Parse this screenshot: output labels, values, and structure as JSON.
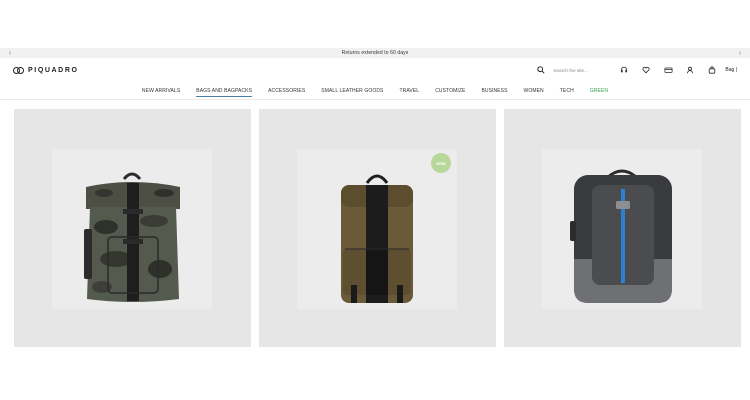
{
  "promo": {
    "text": "Returns extended to 60 days",
    "prev_icon": "chevron-left-icon",
    "next_icon": "chevron-right-icon"
  },
  "header": {
    "logo_text": "PIQUADRO",
    "search_placeholder": "Search the site...",
    "bag_label": "Bag |",
    "icons": [
      "search-icon",
      "support-icon",
      "heart-icon",
      "card-icon",
      "user-icon",
      "bag-icon"
    ]
  },
  "nav": {
    "items": [
      {
        "label": "NEW ARRIVALS"
      },
      {
        "label": "BAGS AND BAGPACKS"
      },
      {
        "label": "ACCESSORIES"
      },
      {
        "label": "SMALL LEATHER GOODS"
      },
      {
        "label": "TRAVEL"
      },
      {
        "label": "CUSTOMIZE"
      },
      {
        "label": "BUSINESS"
      },
      {
        "label": "WOMEN"
      },
      {
        "label": "TECH"
      },
      {
        "label": "GREEN"
      }
    ],
    "active": "BAGS AND BAGPACKS",
    "green_color": "#3a9d4a",
    "active_underline": "#4a7fa8"
  },
  "products": [
    {
      "image": "camo-rolltop-backpack",
      "badge": ""
    },
    {
      "image": "olive-brown-backpack",
      "badge": "NEW"
    },
    {
      "image": "grey-business-backpack",
      "badge": ""
    }
  ],
  "colors": {
    "card_bg": "#e6e6e6",
    "badge_bg": "#b8d89a"
  }
}
